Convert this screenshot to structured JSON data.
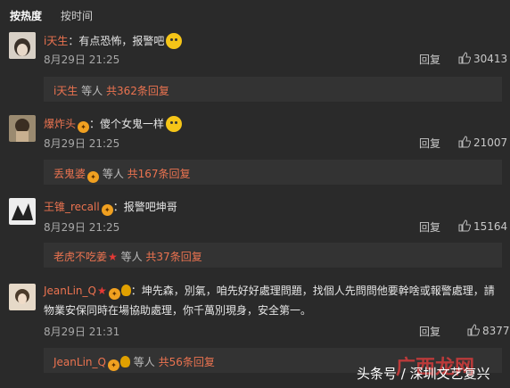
{
  "sort": {
    "hot": "按热度",
    "time": "按时间"
  },
  "comments": [
    {
      "username": "i天生",
      "text": "：有点恐怖，报警吧",
      "date": "8月29日 21:25",
      "reply": "回复",
      "likes": "30413",
      "sub": {
        "name": "i天生",
        "mid": " 等人 ",
        "total": "共362条回复"
      }
    },
    {
      "username": "爆炸头",
      "text": "：傻个女鬼一样",
      "date": "8月29日 21:25",
      "reply": "回复",
      "likes": "21007",
      "sub": {
        "name": "丢鬼婆",
        "mid": " 等人 ",
        "total": "共167条回复"
      }
    },
    {
      "username": "王锥_recall",
      "text": "：报警吧坤哥",
      "date": "8月29日 21:25",
      "reply": "回复",
      "likes": "15164",
      "sub": {
        "name": "老虎不吃姜",
        "mid": " 等人 ",
        "total": "共37条回复"
      }
    },
    {
      "username": "JeanLin_Q",
      "text": "：坤先森，別氣，咱先好好處理問題，找個人先問問他要幹啥或報警處理，請",
      "text2": "物業安保同時在場協助處理，你千萬別現身，安全第一。",
      "date": "8月29日 21:31",
      "reply": "回复",
      "likes": "8377",
      "sub": {
        "name": "JeanLin_Q",
        "mid": " 等人 ",
        "total": "共56条回复"
      }
    }
  ],
  "watermark": {
    "text": "头条号 / 深圳文艺复兴",
    "logo": "广西龙网"
  },
  "colors": {
    "accent": "#eb7350",
    "background": "#2a2a2a"
  }
}
